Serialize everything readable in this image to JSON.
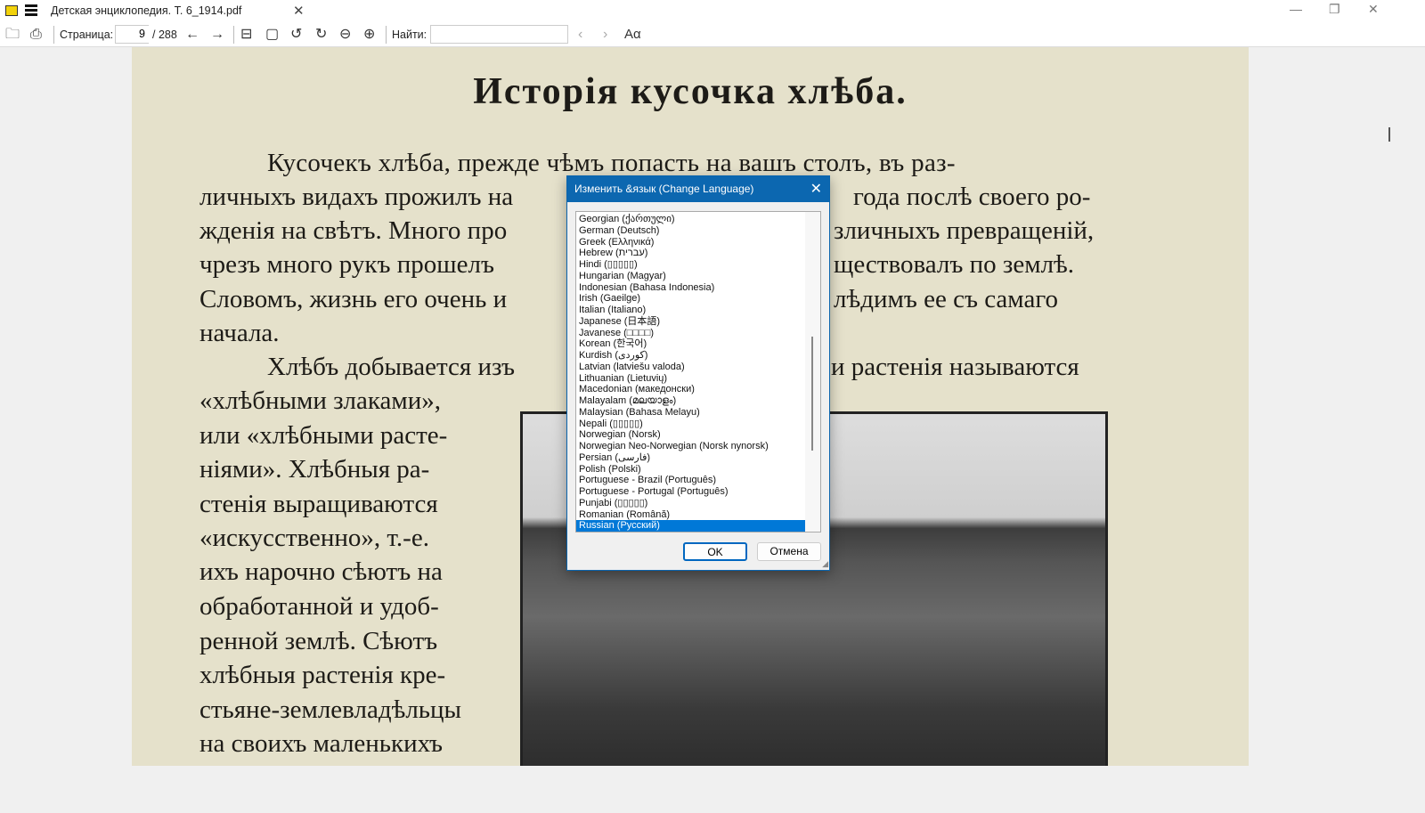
{
  "window": {
    "title": "Детская энциклопедия. Т. 6_1914.pdf",
    "app_icon": "PDF"
  },
  "toolbar": {
    "page_label": "Страница:",
    "page_value": "9",
    "page_total": "/ 288",
    "find_label": "Найти:",
    "find_value": "",
    "font_icon": "Aα"
  },
  "document": {
    "title": "Исторія кусочка хлѣба.",
    "lines": [
      "Кусочекъ хлѣба, прежде чѣмъ попасть на вашъ столъ, въ раз-",
      "личныхъ видахъ прожилъ на",
      "года послѣ своего ро-",
      "жденія на свѣтъ. Много про",
      "зличныхъ превращеній,",
      "чрезъ много рукъ прошелъ",
      "ществовалъ по землѣ.",
      "Словомъ, жизнь его очень и",
      "лѣдимъ ее съ самаго",
      "начала.",
      "Хлѣбъ добывается изъ",
      "и растенія называются",
      "«хлѣбными злаками»,",
      "или «хлѣбными расте-",
      "ніями». Хлѣбныя ра-",
      "стенія выращиваются",
      "«искусственно», т.-е.",
      "ихъ нарочно сѣютъ на",
      "обработанной и удоб-",
      "ренной землѣ. Сѣютъ",
      "хлѣбныя растенія кре-",
      "стьяне-землевладѣльцы",
      "на своихъ маленькихъ"
    ]
  },
  "dialog": {
    "title": "Изменить &язык (Change Language)",
    "languages": [
      "Georgian (ქართული)",
      "German (Deutsch)",
      "Greek (Ελληνικά)",
      "Hebrew (עברית)",
      "Hindi (▯▯▯▯▯)",
      "Hungarian (Magyar)",
      "Indonesian (Bahasa Indonesia)",
      "Irish (Gaeilge)",
      "Italian (Italiano)",
      "Japanese (日本語)",
      "Javanese (□□□□)",
      "Korean (한국어)",
      "Kurdish (کوردی)",
      "Latvian (latviešu valoda)",
      "Lithuanian (Lietuvių)",
      "Macedonian (македонски)",
      "Malayalam (മലയാളം)",
      "Malaysian (Bahasa Melayu)",
      "Nepali (▯▯▯▯▯)",
      "Norwegian (Norsk)",
      "Norwegian Neo-Norwegian (Norsk nynorsk)",
      "Persian (فارسی)",
      "Polish (Polski)",
      "Portuguese - Brazil (Português)",
      "Portuguese - Portugal (Português)",
      "Punjabi (▯▯▯▯▯)",
      "Romanian (Română)",
      "Russian (Русский)"
    ],
    "selected": "Russian (Русский)",
    "ok": "OK",
    "cancel": "Отмена"
  }
}
